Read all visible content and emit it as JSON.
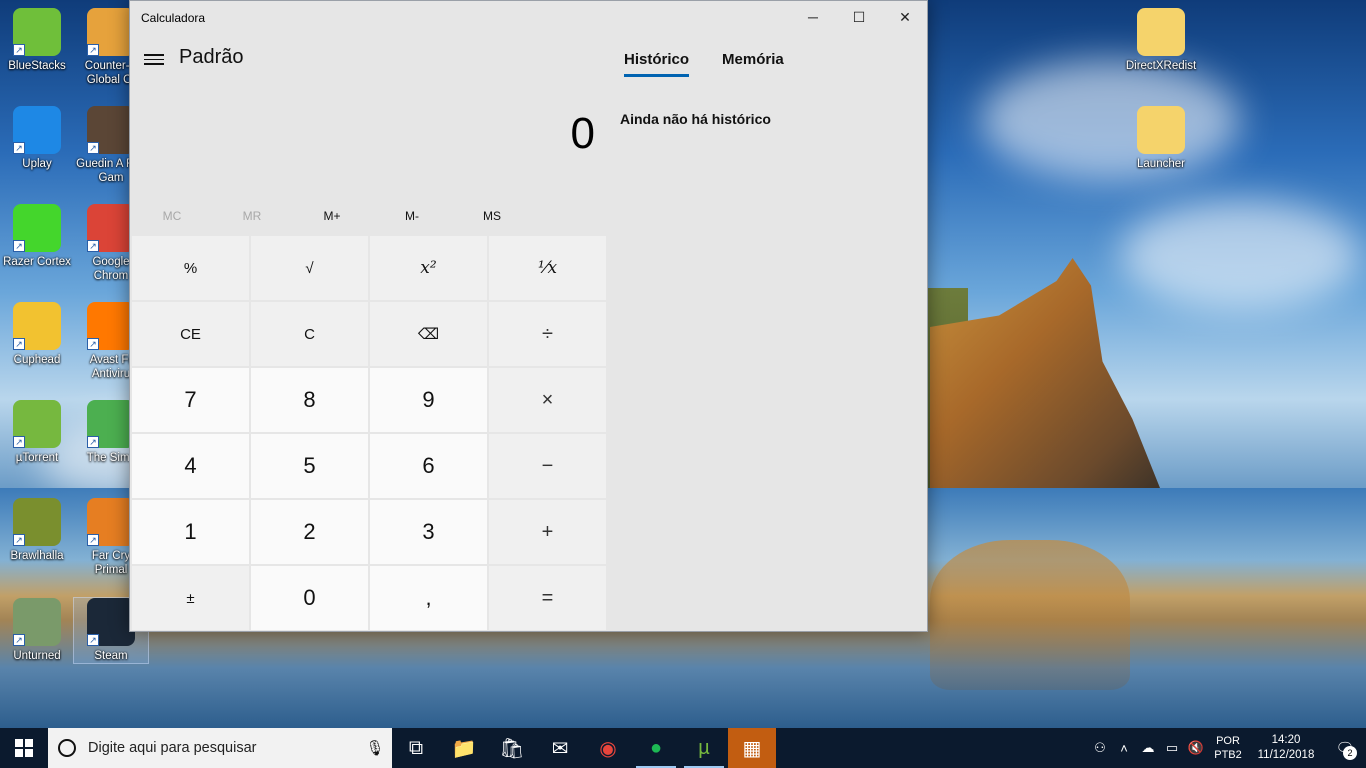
{
  "desktop": {
    "icons": [
      {
        "label": "BlueStacks",
        "icon": "bluestacks-icon",
        "color": "#6fbf3a"
      },
      {
        "label": "Counter-S Global Of",
        "icon": "csgo-icon",
        "color": "#e6a23c"
      },
      {
        "label": "Uplay",
        "icon": "uplay-icon",
        "color": "#1e88e5"
      },
      {
        "label": "Guedin A Fan Gam",
        "icon": "game-icon",
        "color": "#5b4636"
      },
      {
        "label": "Razer Cortex",
        "icon": "razer-cortex-icon",
        "color": "#44d62c"
      },
      {
        "label": "Google Chrom",
        "icon": "chrome-icon",
        "color": "#db4437"
      },
      {
        "label": "Cuphead",
        "icon": "cuphead-icon",
        "color": "#f2c230"
      },
      {
        "label": "Avast Fr Antiviru",
        "icon": "avast-icon",
        "color": "#ff7800"
      },
      {
        "label": "µTorrent",
        "icon": "utorrent-icon",
        "color": "#76b83f"
      },
      {
        "label": "The Sims",
        "icon": "sims-icon",
        "color": "#4caf50"
      },
      {
        "label": "Brawlhalla",
        "icon": "brawlhalla-icon",
        "color": "#7a8f2e"
      },
      {
        "label": "Far Cry Primal",
        "icon": "farcry-icon",
        "color": "#e67e22"
      },
      {
        "label": "Unturned",
        "icon": "unturned-icon",
        "color": "#7a9a6a"
      },
      {
        "label": "Steam",
        "icon": "steam-icon",
        "color": "#1b2838"
      },
      {
        "label": "DirectXRedist",
        "icon": "folder-icon",
        "color": "#f5d36b"
      },
      {
        "label": "Launcher",
        "icon": "folder-icon",
        "color": "#f5d36b"
      }
    ]
  },
  "calculator": {
    "window_title": "Calculadora",
    "mode": "Padrão",
    "display": "0",
    "memory": [
      "MC",
      "MR",
      "M+",
      "M-",
      "MS"
    ],
    "memory_disabled": [
      true,
      true,
      false,
      false,
      false
    ],
    "keys": [
      {
        "label": "%",
        "kind": "fn",
        "name": "percent-key"
      },
      {
        "label": "√",
        "kind": "fn",
        "name": "sqrt-key"
      },
      {
        "label": "x²",
        "kind": "fn",
        "name": "square-key"
      },
      {
        "label": "¹⁄x",
        "kind": "fn",
        "name": "reciprocal-key"
      },
      {
        "label": "CE",
        "kind": "fn",
        "name": "clear-entry-key"
      },
      {
        "label": "C",
        "kind": "fn",
        "name": "clear-key"
      },
      {
        "label": "⌫",
        "kind": "fn",
        "name": "backspace-key"
      },
      {
        "label": "÷",
        "kind": "op",
        "name": "divide-key"
      },
      {
        "label": "7",
        "kind": "num",
        "name": "digit-7-key"
      },
      {
        "label": "8",
        "kind": "num",
        "name": "digit-8-key"
      },
      {
        "label": "9",
        "kind": "num",
        "name": "digit-9-key"
      },
      {
        "label": "×",
        "kind": "op",
        "name": "multiply-key"
      },
      {
        "label": "4",
        "kind": "num",
        "name": "digit-4-key"
      },
      {
        "label": "5",
        "kind": "num",
        "name": "digit-5-key"
      },
      {
        "label": "6",
        "kind": "num",
        "name": "digit-6-key"
      },
      {
        "label": "−",
        "kind": "op",
        "name": "subtract-key"
      },
      {
        "label": "1",
        "kind": "num",
        "name": "digit-1-key"
      },
      {
        "label": "2",
        "kind": "num",
        "name": "digit-2-key"
      },
      {
        "label": "3",
        "kind": "num",
        "name": "digit-3-key"
      },
      {
        "label": "+",
        "kind": "op",
        "name": "add-key"
      },
      {
        "label": "±",
        "kind": "fn",
        "name": "negate-key"
      },
      {
        "label": "0",
        "kind": "num",
        "name": "digit-0-key"
      },
      {
        "label": ",",
        "kind": "num",
        "name": "decimal-key"
      },
      {
        "label": "=",
        "kind": "op",
        "name": "equals-key"
      }
    ],
    "tabs": [
      "Histórico",
      "Memória"
    ],
    "active_tab": "Histórico",
    "empty_history": "Ainda não há histórico",
    "accent": "#0063b1"
  },
  "taskbar": {
    "search_placeholder": "Digite aqui para pesquisar",
    "pinned": [
      {
        "icon": "task-view-icon",
        "active": false
      },
      {
        "icon": "file-explorer-icon",
        "active": false
      },
      {
        "icon": "store-icon",
        "active": false
      },
      {
        "icon": "mail-icon",
        "active": false
      },
      {
        "icon": "chrome-icon",
        "active": false
      },
      {
        "icon": "spotify-icon",
        "active": true
      },
      {
        "icon": "utorrent-icon",
        "active": true
      },
      {
        "icon": "calculator-icon",
        "active": true
      }
    ],
    "language": "POR",
    "keyboard": "PTB2",
    "time": "14:20",
    "date": "11/12/2018",
    "notifications": "2"
  }
}
